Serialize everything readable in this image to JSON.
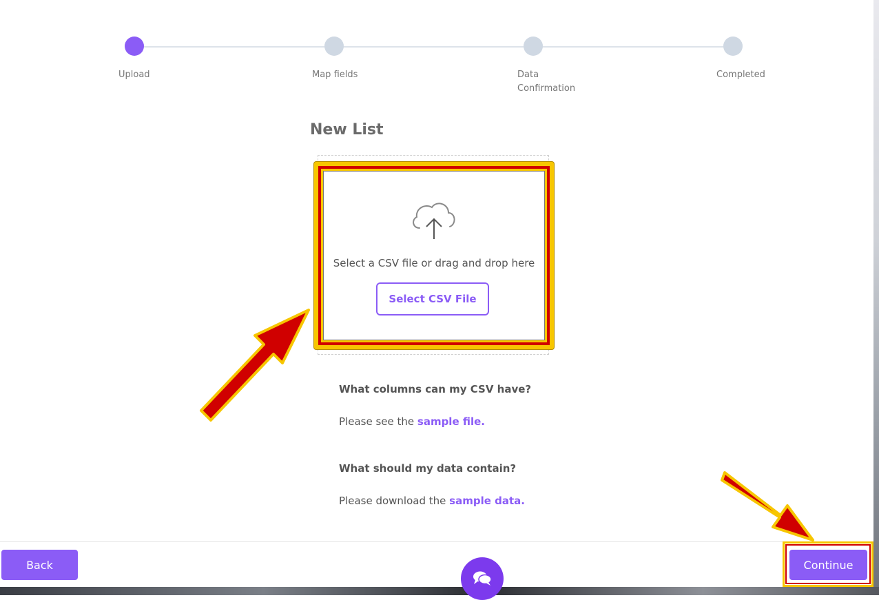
{
  "stepper": {
    "steps": [
      {
        "label": "Upload"
      },
      {
        "label": "Map fields"
      },
      {
        "label": "Data\nConfirmation"
      },
      {
        "label": "Completed"
      }
    ]
  },
  "main": {
    "title": "New List",
    "dropzone": {
      "text": "Select a CSV file or drag and drop here",
      "button_label": "Select CSV File"
    },
    "faq": [
      {
        "question": "What columns can my CSV have?",
        "answer_prefix": "Please see the",
        "link": "sample file."
      },
      {
        "question": "What should my data contain?",
        "answer_prefix": "Please download the",
        "link": "sample data."
      }
    ]
  },
  "footer": {
    "back_label": "Back",
    "continue_label": "Continue"
  },
  "colors": {
    "accent": "#8b5cf6",
    "step_inactive": "#cfd8e3",
    "highlight_yellow": "#f7c600",
    "highlight_red": "#d00000"
  }
}
